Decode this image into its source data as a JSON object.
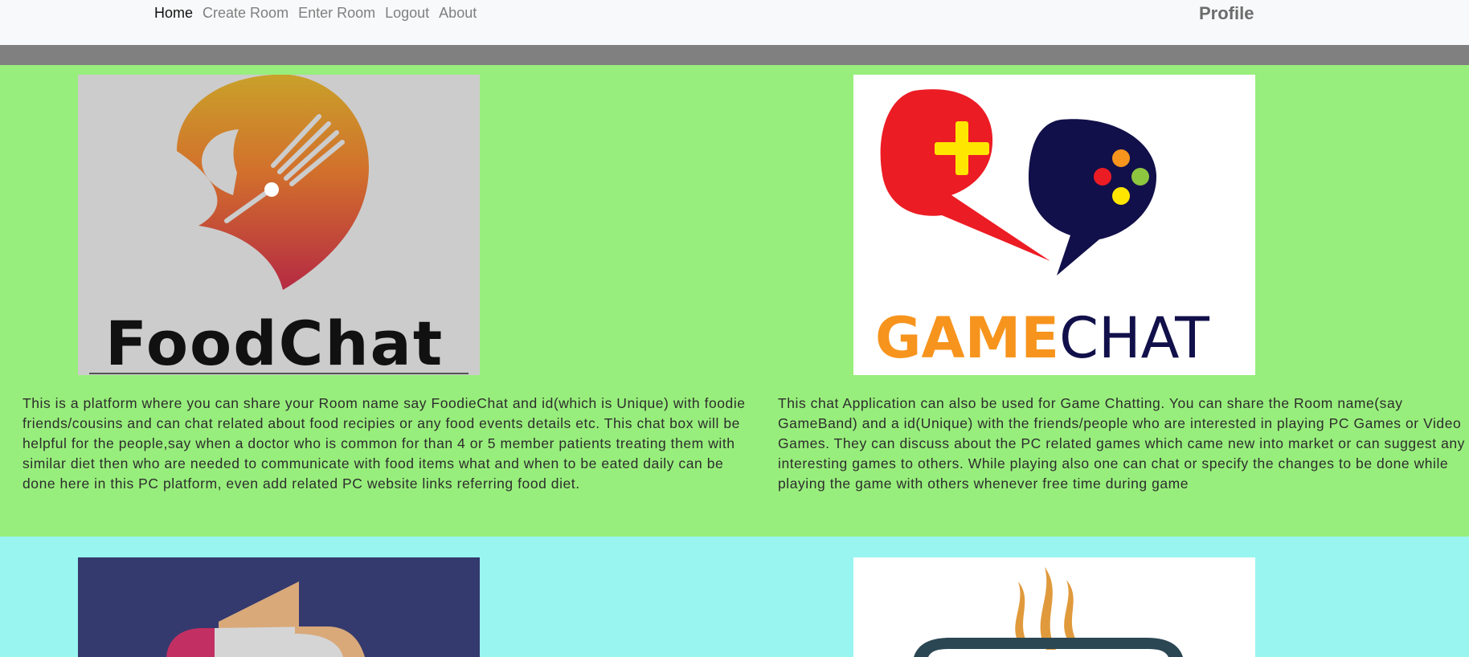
{
  "nav": {
    "links": [
      {
        "label": "Home",
        "active": true
      },
      {
        "label": "Create Room"
      },
      {
        "label": "Enter Room"
      },
      {
        "label": "Logout"
      },
      {
        "label": "About"
      }
    ],
    "profile": "Profile"
  },
  "cards": {
    "food": {
      "logo_text": "FoodChat",
      "description": "This is a platform where you can share your Room name say FoodieChat and id(which is Unique) with foodie friends/cousins and can chat related about food recipies or any food events details etc. This chat box will be helpful for the people,say when a doctor who is common for than 4 or 5 member patients treating them with similar diet then who are needed to communicate with food items what and when to be eated daily can be done here in this PC platform, even add related PC website links referring food diet."
    },
    "game": {
      "logo_text_game": "GAME",
      "logo_text_chat": "CHAT",
      "description": "This chat Application can also be used for Game Chatting. You can share the Room name(say GameBand) and a id(Unique) with the friends/people who are interested in playing PC Games or Video Games. They can discuss about the PC related games which came new into market or can suggest any interesting games to others. While playing also one can chat or specify the changes to be done while playing the game with others whenever free time during game"
    }
  },
  "colors": {
    "green_section": "#98ee7c",
    "cyan_section": "#98f5ef",
    "grey_strip": "#808080",
    "navbar_bg": "#f8f9fa"
  }
}
